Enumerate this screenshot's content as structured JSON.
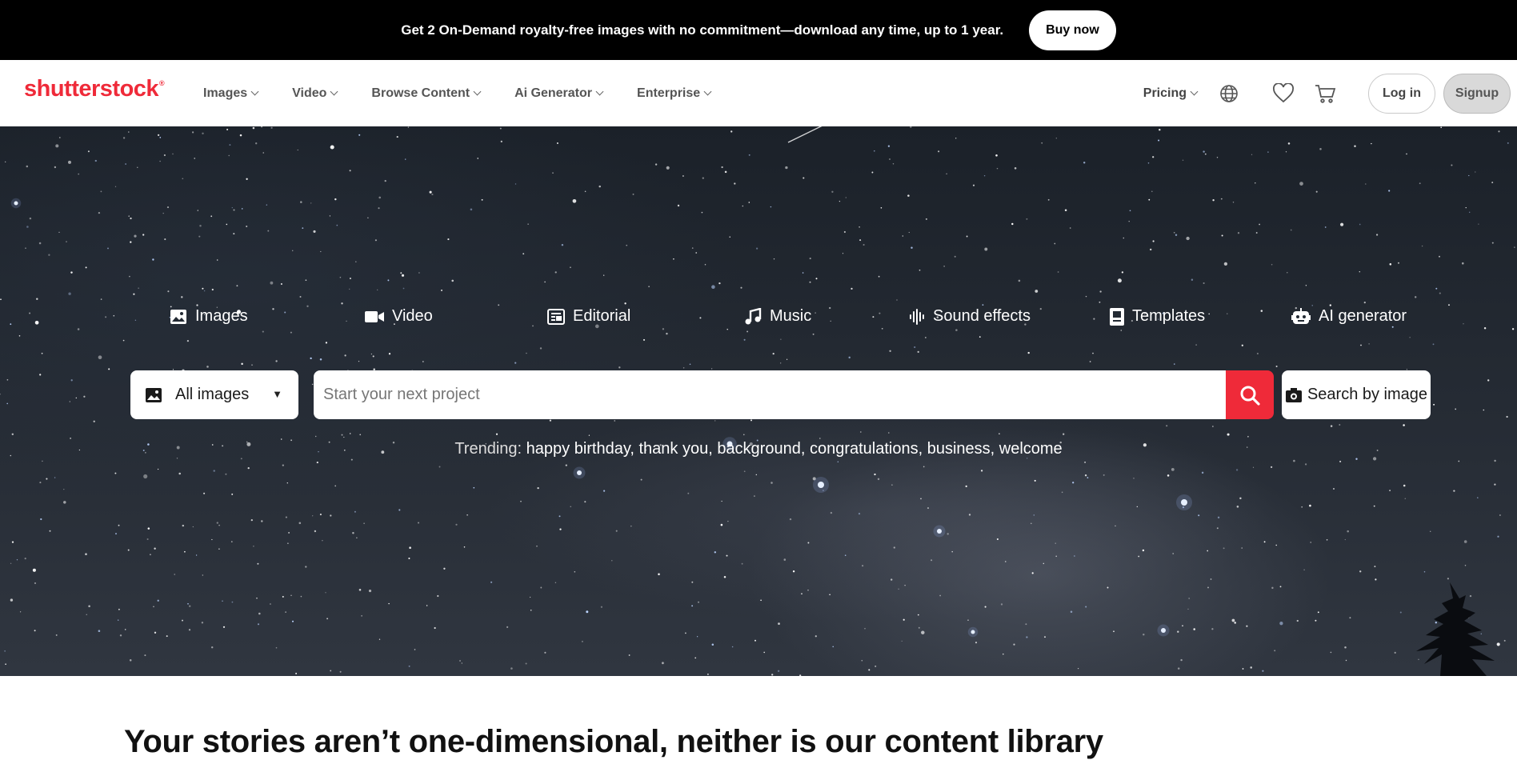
{
  "promo": {
    "text": "Get 2 On-Demand royalty-free images with no commitment—download any time, up to 1 year.",
    "button": "Buy now"
  },
  "header": {
    "logo": "shutterstock",
    "nav": [
      "Images",
      "Video",
      "Browse Content",
      "Ai Generator",
      "Enterprise"
    ],
    "pricing": "Pricing",
    "login": "Log in",
    "signup": "Signup",
    "icons": [
      "globe-icon",
      "heart-icon",
      "cart-icon"
    ]
  },
  "hero": {
    "tabs": [
      {
        "label": "Images",
        "icon": "image-icon"
      },
      {
        "label": "Video",
        "icon": "video-icon"
      },
      {
        "label": "Editorial",
        "icon": "newspaper-icon"
      },
      {
        "label": "Music",
        "icon": "music-icon"
      },
      {
        "label": "Sound effects",
        "icon": "soundwave-icon"
      },
      {
        "label": "Templates",
        "icon": "template-icon"
      },
      {
        "label": "AI generator",
        "icon": "robot-icon"
      }
    ],
    "type_select": "All images",
    "search_placeholder": "Start your next project",
    "search_by_image": "Search by image",
    "trending_label": "Trending:",
    "trending_terms": "happy birthday, thank you, background, congratulations, business, welcome"
  },
  "headline": "Your stories aren’t one-dimensional, neither is our content library",
  "colors": {
    "brand": "#ef2a39",
    "promo_bg": "#000000",
    "hero_bg": "#232a33"
  }
}
